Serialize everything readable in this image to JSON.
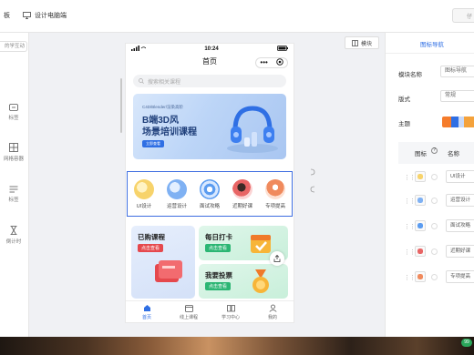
{
  "toolbar": {
    "item1_label": "板",
    "item2_label": "设计电脑端",
    "right_label": "仔"
  },
  "left_panel": {
    "top_label": "的学互动",
    "items": [
      {
        "label": "标签",
        "icon": "badge-icon"
      },
      {
        "label": "网格容器",
        "icon": "grid-icon"
      },
      {
        "label": "标签",
        "icon": "tabs-icon"
      },
      {
        "label": "倒计时",
        "icon": "hourglass-icon"
      }
    ]
  },
  "phone": {
    "time": "10:24",
    "title": "首页",
    "search_placeholder": "搜索相关课程",
    "banner": {
      "subtitle": "C4D/Blender/渲染高阶",
      "title_line1": "B端3D风",
      "title_line2": "场景培训课程",
      "button": "立即查看"
    },
    "grid_items": [
      {
        "label": "UI设计",
        "color": "#f7d36b"
      },
      {
        "label": "运营设计",
        "color": "#7fb1f3"
      },
      {
        "label": "面试攻略",
        "color": "#5b9cf0"
      },
      {
        "label": "近期好课",
        "color": "#e86565"
      },
      {
        "label": "专项提高",
        "color": "#f08a5d"
      }
    ],
    "cards": {
      "purchased": {
        "title": "已购课程",
        "button": "点击查看"
      },
      "checkin": {
        "title": "每日打卡",
        "button": "点击查看"
      },
      "vote": {
        "title": "我要投票",
        "button": "点击查看"
      }
    },
    "tabbar": [
      {
        "label": "首页",
        "active": true
      },
      {
        "label": "线上课程",
        "active": false
      },
      {
        "label": "学习中心",
        "active": false
      },
      {
        "label": "我的",
        "active": false
      }
    ]
  },
  "module_button": "模块",
  "right_panel": {
    "title": "图标导航",
    "module_name_label": "模块名称",
    "module_name_value": "图标导航",
    "layout_label": "版式",
    "layout_value": "常规",
    "theme_label": "主题",
    "table_header_icon": "图标",
    "table_header_name": "名称",
    "rows": [
      "UI设计",
      "运营设计",
      "面试攻略",
      "近期好课",
      "专项提高"
    ]
  },
  "bottom_badge": "99"
}
